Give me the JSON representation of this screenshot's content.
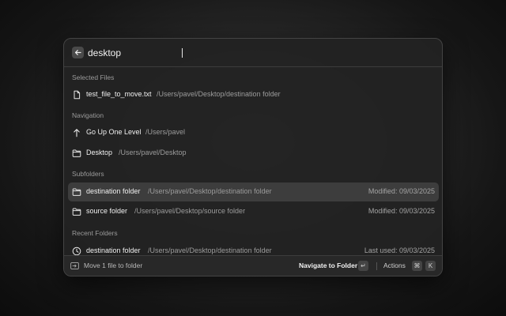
{
  "search": {
    "value": "desktop"
  },
  "sections": {
    "selected_files": "Selected Files",
    "navigation": "Navigation",
    "subfolders": "Subfolders",
    "recent_folders": "Recent Folders"
  },
  "selected_files": [
    {
      "name": "test_file_to_move.txt",
      "path": "/Users/pavel/Desktop/destination folder",
      "icon": "file-icon"
    }
  ],
  "navigation": [
    {
      "name": "Go Up One Level",
      "path": "/Users/pavel",
      "icon": "arrow-up-icon"
    },
    {
      "name": "Desktop",
      "path": "/Users/pavel/Desktop",
      "icon": "folder-icon"
    }
  ],
  "subfolders": [
    {
      "name": "destination folder",
      "path": "/Users/pavel/Desktop/destination folder",
      "meta": "Modified: 09/03/2025",
      "icon": "folder-icon",
      "selected": true
    },
    {
      "name": "source folder",
      "path": "/Users/pavel/Desktop/source folder",
      "meta": "Modified: 09/03/2025",
      "icon": "folder-icon",
      "selected": false
    }
  ],
  "recent_folders": [
    {
      "name": "destination folder",
      "path": "/Users/pavel/Desktop/destination folder",
      "meta": "Last used: 09/03/2025",
      "icon": "clock-icon"
    }
  ],
  "footer": {
    "status": "Move 1 file to folder",
    "primary_action": "Navigate to Folder",
    "enter_key": "↵",
    "actions_label": "Actions",
    "cmd_key": "⌘",
    "k_key": "K"
  }
}
